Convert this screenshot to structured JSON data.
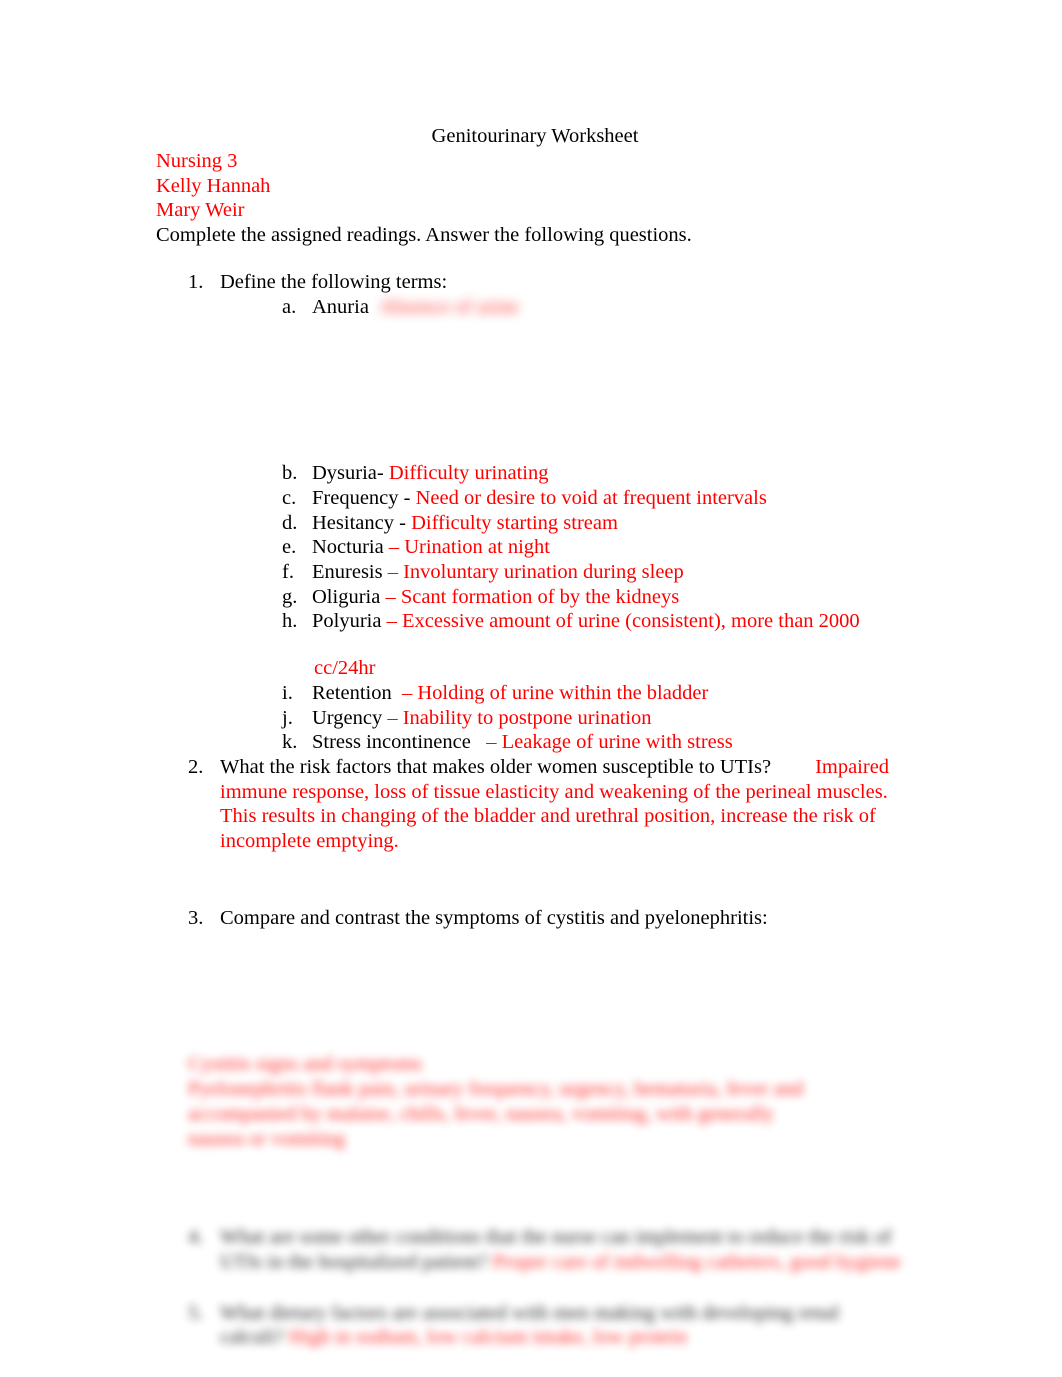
{
  "document": {
    "title": "Genitourinary Worksheet",
    "course": "Nursing 3",
    "author_1": "Kelly Hannah",
    "author_2": "Mary Weir",
    "instructions": "Complete the assigned readings. Answer the following questions.",
    "colors": {
      "answer_red": "#FF0000",
      "question_black": "#000000",
      "page_background": "#FFFFFF"
    }
  },
  "questions": {
    "q1": {
      "number": "1.",
      "prompt": "Define the following terms:",
      "terms": [
        {
          "marker": "a.",
          "term": "Anuria",
          "separator": "",
          "definition": "Absence of urine",
          "redacted": true
        },
        {
          "marker": "b.",
          "term": "Dysuria",
          "separator": "-",
          "definition": "Difficulty urinating",
          "redacted": false
        },
        {
          "marker": "c.",
          "term": "Frequency",
          "separator": "-",
          "definition": "Need or desire to void at frequent intervals",
          "redacted": false
        },
        {
          "marker": "d.",
          "term": "Hesitancy",
          "separator": "-",
          "definition": "Difficulty starting stream",
          "redacted": false
        },
        {
          "marker": "e.",
          "term": "Nocturia",
          "separator": "–",
          "definition": "Urination at night",
          "redacted": false
        },
        {
          "marker": "f.",
          "term": "Enuresis",
          "separator": "–",
          "definition": "Involuntary urination during sleep",
          "redacted": false
        },
        {
          "marker": "g.",
          "term": "Oliguria",
          "separator": "–",
          "definition": "Scant formation of by the kidneys",
          "redacted": false
        },
        {
          "marker": "h.",
          "term": "Polyuria",
          "separator": "–",
          "definition": "Excessive amount of urine (consistent), more than 2000",
          "definition_continued": "cc/24hr",
          "redacted": false
        },
        {
          "marker": "i.",
          "term": "Retention",
          "separator": "–",
          "definition": "Holding of urine within the bladder",
          "redacted": false
        },
        {
          "marker": "j.",
          "term": "Urgency",
          "separator": "–",
          "definition": "Inability to postpone urination",
          "redacted": false
        },
        {
          "marker": "k.",
          "term": "Stress incontinence",
          "separator": "–",
          "definition": "Leakage of urine with stress",
          "redacted": false
        }
      ]
    },
    "q2": {
      "number": "2.",
      "prompt": "What the risk factors that makes older women susceptible to UTIs?",
      "answer": "Impaired immune response, loss of tissue elasticity and weakening of the perineal muscles. This results in changing of the bladder and urethral position, increase the risk of incomplete emptying.",
      "redacted": false
    },
    "q3": {
      "number": "3.",
      "prompt": "Compare and contrast the symptoms of cystitis and pyelonephritis:",
      "answer_line_1": "Cystitis signs and symptoms",
      "answer_line_2": "Pyelonephritis flank pain, urinary frequency, urgency, hematuria, fever and",
      "answer_line_3": "accompanied by malaise, chills, fever, nausea, vomiting, with generally",
      "answer_line_4": "nausea or vomiting",
      "redacted": true
    },
    "q4": {
      "number": "4.",
      "prompt_line_1": "What are some other conditions that the nurse can implement to reduce the risk",
      "prompt_line_2": "of UTIs in the hospitalized patient?",
      "answer_line_1": "Proper care of indwelling catheters,",
      "answer_line_2": "good hygiene",
      "redacted": true
    },
    "q5": {
      "number": "5.",
      "prompt_line_1": "What dietary factors are associated with men making with developing renal",
      "prompt_line_2": "calculi?",
      "answer": "High in sodium, low calcium intake, low protein",
      "redacted": true
    }
  }
}
